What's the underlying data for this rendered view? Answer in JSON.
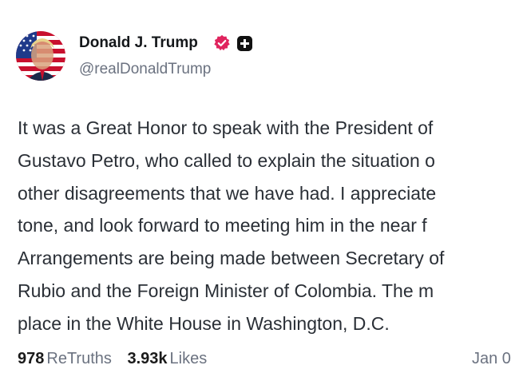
{
  "author": {
    "display_name": "Donald J. Trump",
    "handle": "@realDonaldTrump",
    "verified_badge": "verified-check-icon",
    "verified_color": "#e0245e",
    "extra_badge": "plus-badge-icon",
    "avatar": "profile-avatar"
  },
  "post": {
    "lines": [
      "It was a Great Honor to speak with the President of",
      "Gustavo Petro, who called to explain the situation o",
      "other disagreements that we have had. I appreciate",
      "tone, and look forward to meeting him in the near f",
      "Arrangements are being made between Secretary of",
      "Rubio and the Foreign Minister of Colombia. The m",
      "place in the White House in Washington, D.C."
    ]
  },
  "stats": {
    "retruths_count": "978",
    "retruths_label": "ReTruths",
    "likes_count": "3.93k",
    "likes_label": "Likes",
    "timestamp": "Jan 0"
  }
}
